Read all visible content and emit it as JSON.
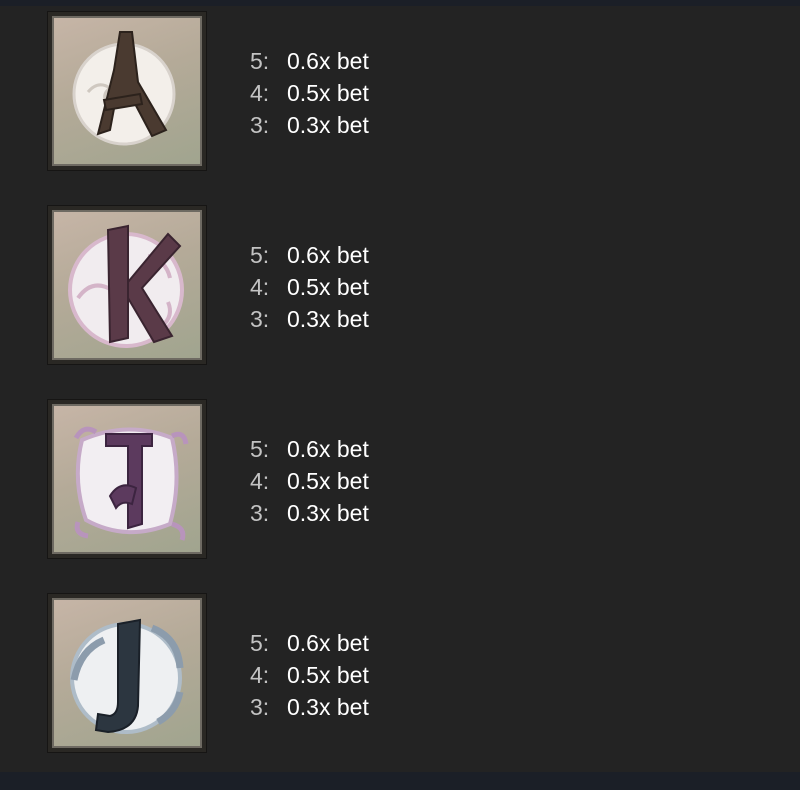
{
  "symbols": [
    {
      "name": "A",
      "payouts": [
        {
          "count": "5:",
          "value": "0.6x bet"
        },
        {
          "count": "4:",
          "value": "0.5x bet"
        },
        {
          "count": "3:",
          "value": "0.3x bet"
        }
      ]
    },
    {
      "name": "K",
      "payouts": [
        {
          "count": "5:",
          "value": "0.6x bet"
        },
        {
          "count": "4:",
          "value": "0.5x bet"
        },
        {
          "count": "3:",
          "value": "0.3x bet"
        }
      ]
    },
    {
      "name": "Q",
      "payouts": [
        {
          "count": "5:",
          "value": "0.6x bet"
        },
        {
          "count": "4:",
          "value": "0.5x bet"
        },
        {
          "count": "3:",
          "value": "0.3x bet"
        }
      ]
    },
    {
      "name": "J",
      "payouts": [
        {
          "count": "5:",
          "value": "0.6x bet"
        },
        {
          "count": "4:",
          "value": "0.5x bet"
        },
        {
          "count": "3:",
          "value": "0.3x bet"
        }
      ]
    }
  ],
  "colors": {
    "background": "#232323",
    "count_text": "#c3c3c3",
    "value_text": "#ffffff",
    "symbol_a": "#4a3a30",
    "symbol_k": "#5a3a48",
    "symbol_q": "#5c3a5e",
    "symbol_j": "#2c3640"
  }
}
